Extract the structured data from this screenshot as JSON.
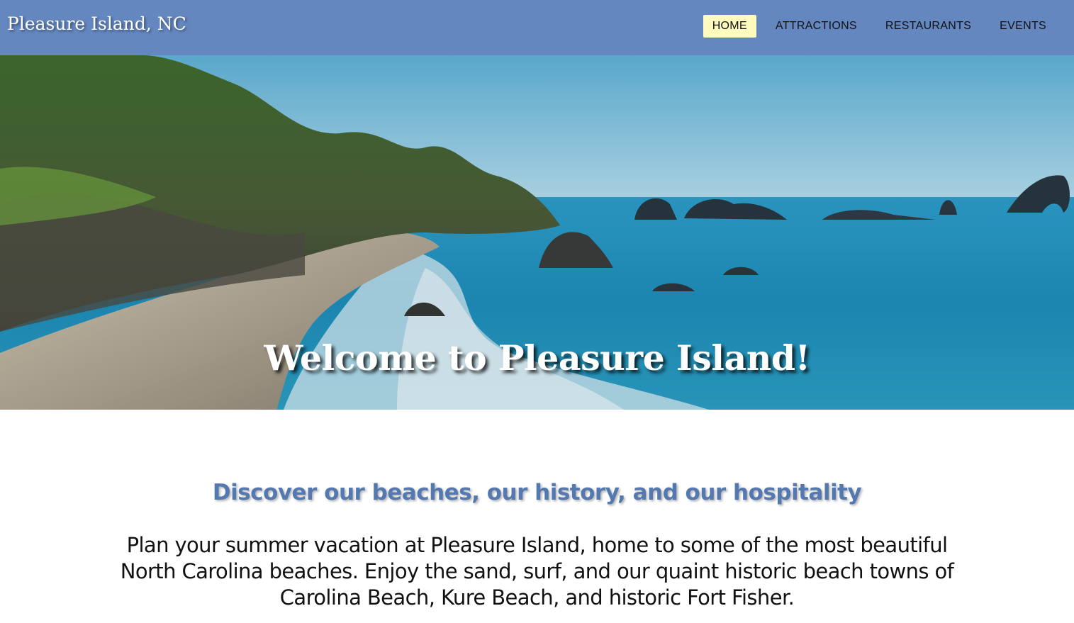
{
  "header": {
    "brand": "Pleasure Island, NC",
    "nav": [
      {
        "label": "HOME",
        "active": true
      },
      {
        "label": "ATTRACTIONS",
        "active": false
      },
      {
        "label": "RESTAURANTS",
        "active": false
      },
      {
        "label": "EVENTS",
        "active": false
      }
    ]
  },
  "hero": {
    "title": "Welcome to Pleasure Island!"
  },
  "main": {
    "subheading": "Discover our beaches, our history, and our hospitality",
    "intro_lines": [
      "Plan your summer vacation at Pleasure Island, home to some of the most beautiful",
      "North Carolina beaches. Enjoy the sand, surf, and our quaint historic beach towns of",
      "Carolina Beach, Kure Beach, and historic Fort Fisher."
    ]
  },
  "colors": {
    "navbar": "#6487bf",
    "active_nav": "#fffbbf",
    "subheading": "#5478b0"
  }
}
